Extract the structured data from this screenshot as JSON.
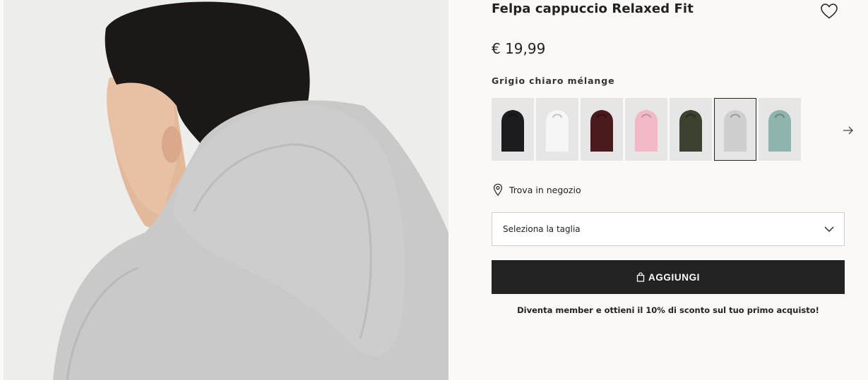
{
  "product": {
    "title": "Felpa cappuccio Relaxed Fit",
    "price": "€ 19,99",
    "color_name": "Grigio chiaro mélange",
    "image": {
      "icon": "hoodie-model-photo"
    }
  },
  "swatches": [
    {
      "name": "black",
      "color": "#1c1c1e",
      "selected": false
    },
    {
      "name": "white",
      "color": "#f6f6f6",
      "selected": false
    },
    {
      "name": "burgundy",
      "color": "#4b1a1c",
      "selected": false
    },
    {
      "name": "light-pink",
      "color": "#f2b8c6",
      "selected": false
    },
    {
      "name": "dark-khaki",
      "color": "#3b4230",
      "selected": false
    },
    {
      "name": "light-grey-melange",
      "color": "#cfcfcf",
      "selected": true
    },
    {
      "name": "mint-green",
      "color": "#8fb3ad",
      "selected": false
    }
  ],
  "store": {
    "label": "Trova in negozio",
    "icon": "location-pin-icon"
  },
  "size_select": {
    "label": "Seleziona la taglia",
    "icon": "chevron-down-icon"
  },
  "add_button": {
    "label": "AGGIUNGI",
    "icon": "shopping-bag-icon"
  },
  "member_promo": "Diventa member e ottieni il 10% di sconto sul tuo primo acquisto!",
  "colors": {
    "button_bg": "#222222",
    "page_bg": "#faf9f8"
  }
}
